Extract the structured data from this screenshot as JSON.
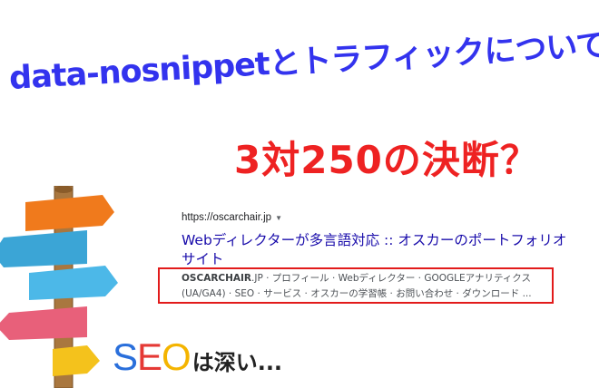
{
  "header": {
    "headline": "data-nosnippetとトラフィックについて",
    "subhead": "3対250の決断？"
  },
  "search_result": {
    "url": "https://oscarchair.jp",
    "title_line1": "Webディレクターが多言語対応 :: オスカーのポートフォリオ",
    "title_line2": "サイト",
    "snippet_brand": "OSCARCHAIR",
    "snippet_line1_rest": ".JP · プロフィール · Webディレクター · GOOGLEアナリティクス",
    "snippet_line2": "(UA/GA4) · SEO · サービス · オスカーの学習帳 · お問い合わせ · ダウンロード ..."
  },
  "footer": {
    "seo_s": "S",
    "seo_e": "E",
    "seo_o": "O",
    "seo_rest": "は深い..."
  },
  "colors": {
    "headline": "#3333ee",
    "subhead": "#ee2222",
    "link": "#1a0dab",
    "highlight_box": "#e21b1b"
  },
  "icons": [
    "signpost-illustration",
    "dropdown-caret-icon"
  ]
}
